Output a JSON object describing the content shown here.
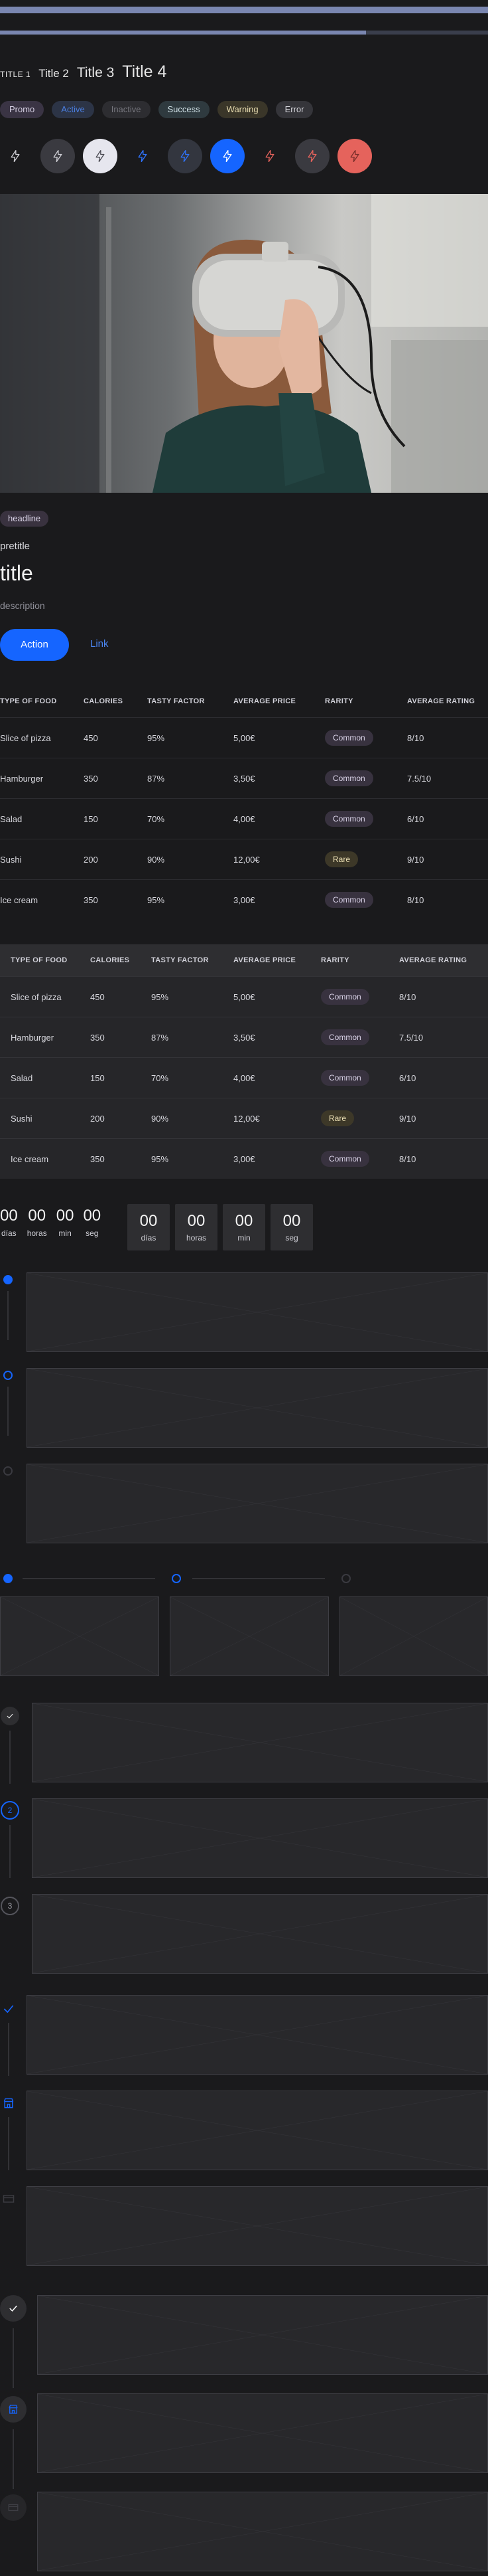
{
  "progress": {
    "top_value": 1.0,
    "second_value": 0.75
  },
  "titles": {
    "t1": "TITLE 1",
    "t2": "Title 2",
    "t3": "Title 3",
    "t4": "Title 4"
  },
  "badges": [
    "Promo",
    "Active",
    "Inactive",
    "Success",
    "Warning",
    "Error"
  ],
  "icon_buttons": [
    {
      "icon": "bolt-icon",
      "variant": "ghost-neutral"
    },
    {
      "icon": "bolt-icon",
      "variant": "filled-dark"
    },
    {
      "icon": "bolt-icon",
      "variant": "filled-light"
    },
    {
      "icon": "bolt-icon",
      "variant": "ghost-blue"
    },
    {
      "icon": "bolt-icon",
      "variant": "filled-dark-blue"
    },
    {
      "icon": "bolt-icon",
      "variant": "filled-blue"
    },
    {
      "icon": "bolt-icon",
      "variant": "ghost-red"
    },
    {
      "icon": "bolt-icon",
      "variant": "filled-dark-red"
    },
    {
      "icon": "bolt-icon",
      "variant": "filled-red"
    }
  ],
  "card": {
    "badge": "headline",
    "pretitle": "pretitle",
    "title": "title",
    "description": "description",
    "action": "Action",
    "link": "Link"
  },
  "table": {
    "columns": [
      "TYPE OF FOOD",
      "CALORIES",
      "TASTY FACTOR",
      "AVERAGE PRICE",
      "RARITY",
      "AVERAGE RATING"
    ],
    "rows": [
      [
        "Slice of pizza",
        "450",
        "95%",
        "5,00€",
        "Common",
        "8/10"
      ],
      [
        "Hamburger",
        "350",
        "87%",
        "3,50€",
        "Common",
        "7.5/10"
      ],
      [
        "Salad",
        "150",
        "70%",
        "4,00€",
        "Common",
        "6/10"
      ],
      [
        "Sushi",
        "200",
        "90%",
        "12,00€",
        "Rare",
        "9/10"
      ],
      [
        "Ice cream",
        "350",
        "95%",
        "3,00€",
        "Common",
        "8/10"
      ]
    ]
  },
  "countdown": {
    "plain": [
      {
        "value": "00",
        "label": "días"
      },
      {
        "value": "00",
        "label": "horas"
      },
      {
        "value": "00",
        "label": "min"
      },
      {
        "value": "00",
        "label": "seg"
      }
    ],
    "boxed": [
      {
        "value": "00",
        "label": "días"
      },
      {
        "value": "00",
        "label": "horas"
      },
      {
        "value": "00",
        "label": "min"
      },
      {
        "value": "00",
        "label": "seg"
      }
    ]
  },
  "steppers": {
    "numbered": [
      "2",
      "3"
    ]
  },
  "colors": {
    "accent": "#1565ff",
    "background": "#1a1a1c",
    "danger": "#e5635c"
  }
}
